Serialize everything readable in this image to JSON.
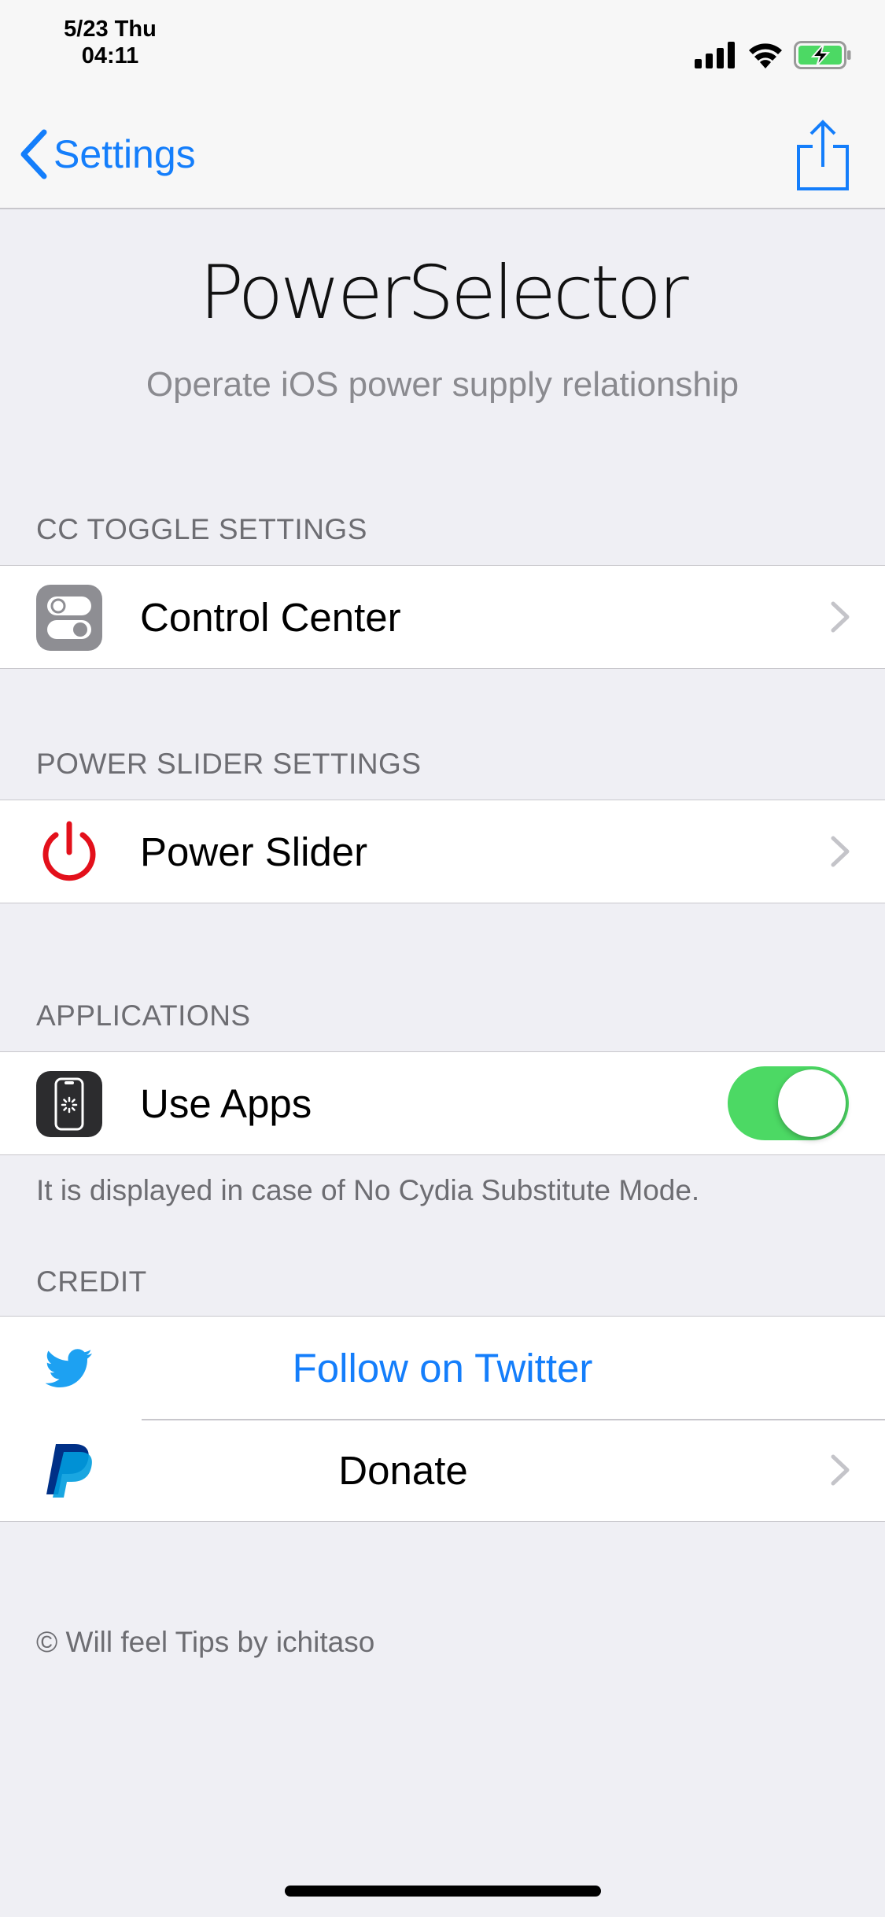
{
  "status_bar": {
    "date": "5/23 Thu",
    "time": "04:11",
    "icons": [
      "cellular-signal-icon",
      "wifi-icon",
      "battery-charging-icon"
    ],
    "battery_color": "#4cd964"
  },
  "nav": {
    "back_label": "Settings",
    "share_icon": "share-icon",
    "accent": "#147efb"
  },
  "header": {
    "title": "PowerSelector",
    "subtitle": "Operate iOS power supply relationship"
  },
  "sections": {
    "cc": {
      "header": "CC TOGGLE SETTINGS",
      "item": {
        "label": "Control Center",
        "icon": "control-center-icon"
      }
    },
    "power": {
      "header": "POWER SLIDER SETTINGS",
      "item": {
        "label": "Power Slider",
        "icon": "power-icon",
        "icon_color": "#e3101b"
      }
    },
    "apps": {
      "header": "APPLICATIONS",
      "item": {
        "label": "Use Apps",
        "icon": "phone-respring-icon",
        "toggle_on": true,
        "toggle_color": "#4cd964"
      },
      "footer": "It is displayed in case of No Cydia Substitute Mode."
    },
    "credit": {
      "header": "CREDIT",
      "twitter": {
        "label": "Follow on Twitter",
        "icon": "twitter-bird-icon",
        "color": "#1da1f2"
      },
      "donate": {
        "label": "Donate",
        "icon": "paypal-icon"
      }
    }
  },
  "copyright": "© Will feel Tips by ichitaso"
}
